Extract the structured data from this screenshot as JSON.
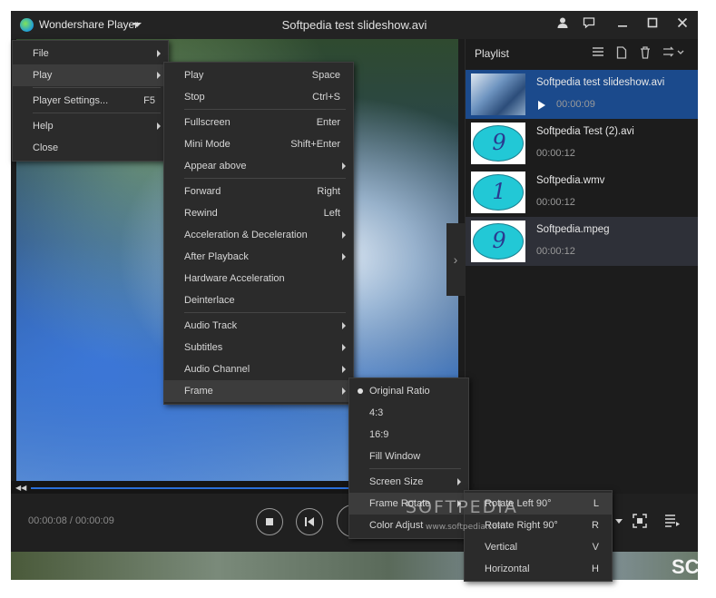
{
  "window": {
    "app_name": "Wondershare Player",
    "title": "Softpedia test slideshow.avi"
  },
  "player": {
    "time": "00:00:08 / 00:00:09",
    "progress": 0.98
  },
  "playlist": {
    "title": "Playlist",
    "items": [
      {
        "name": "Softpedia test slideshow.avi",
        "duration": "00:00:09",
        "thumb": "video",
        "state": "playing"
      },
      {
        "name": "Softpedia Test (2).avi",
        "duration": "00:00:12",
        "thumb": "9"
      },
      {
        "name": "Softpedia.wmv",
        "duration": "00:00:12",
        "thumb": "1"
      },
      {
        "name": "Softpedia.mpeg",
        "duration": "00:00:12",
        "thumb": "9"
      }
    ]
  },
  "menu_main": [
    {
      "label": "File",
      "submenu": true
    },
    {
      "label": "Play",
      "submenu": true,
      "highlighted": true
    },
    {
      "label": "Player Settings...",
      "key": "F5"
    },
    {
      "label": "Help",
      "submenu": true
    },
    {
      "label": "Close"
    }
  ],
  "menu_play": [
    {
      "label": "Play",
      "key": "Space"
    },
    {
      "label": "Stop",
      "key": "Ctrl+S"
    },
    {
      "label": "Fullscreen",
      "key": "Enter"
    },
    {
      "label": "Mini Mode",
      "key": "Shift+Enter"
    },
    {
      "label": "Appear above",
      "submenu": true
    },
    {
      "label": "Forward",
      "key": "Right"
    },
    {
      "label": "Rewind",
      "key": "Left"
    },
    {
      "label": "Acceleration & Deceleration",
      "submenu": true
    },
    {
      "label": "After Playback",
      "submenu": true
    },
    {
      "label": "Hardware Acceleration"
    },
    {
      "label": "Deinterlace"
    },
    {
      "label": "Audio Track",
      "submenu": true
    },
    {
      "label": "Subtitles",
      "submenu": true
    },
    {
      "label": "Audio Channel",
      "submenu": true
    },
    {
      "label": "Frame",
      "submenu": true,
      "highlighted": true
    }
  ],
  "menu_frame": [
    {
      "label": "Original Ratio",
      "selected": true
    },
    {
      "label": "4:3"
    },
    {
      "label": "16:9"
    },
    {
      "label": "Fill Window"
    },
    {
      "label": "Screen Size",
      "submenu": true
    },
    {
      "label": "Frame Rotate",
      "submenu": true,
      "highlighted": true
    },
    {
      "label": "Color Adjust"
    }
  ],
  "menu_rotate": [
    {
      "label": "Rotate Left 90°",
      "key": "L",
      "highlighted": true
    },
    {
      "label": "Rotate Right 90°",
      "key": "R"
    },
    {
      "label": "Vertical",
      "key": "V"
    },
    {
      "label": "Horizontal",
      "key": "H"
    }
  ],
  "watermark": {
    "logo": "SOFTPEDIA",
    "url": "www.softpedia.com"
  },
  "bottom_text": "SC"
}
